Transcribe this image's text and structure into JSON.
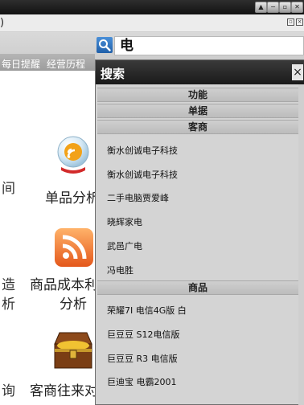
{
  "window": {
    "controls": [
      "▲",
      "−",
      "▫",
      "✕"
    ]
  },
  "menubar": {
    "left_glyph": ")"
  },
  "toolbar": {
    "links": [
      "每日提醒",
      "经营历程"
    ]
  },
  "search": {
    "value": "电",
    "icon": "search-icon"
  },
  "popup": {
    "title": "搜索",
    "close": "×",
    "sections": [
      {
        "label": "功能",
        "items": []
      },
      {
        "label": "单据",
        "items": []
      },
      {
        "label": "客商",
        "items": [
          "衡水创诚电子科技",
          "衡水创诚电子科技",
          "二手电脑贾爱峰",
          "晓辉家电",
          "武邑广电",
          "冯电胜"
        ]
      },
      {
        "label": "商品",
        "items": [
          "荣耀7I 电信4G版 白",
          "巨豆豆 S12电信版",
          "巨豆豆 R3 电信版",
          "巨迪宝 电霸2001"
        ]
      }
    ]
  },
  "left": {
    "fragments": [
      "间",
      "造",
      "析",
      "询"
    ],
    "labels": [
      "单品分析",
      "商品成本利",
      "分析",
      "客商往来对"
    ]
  },
  "colors": {
    "search_blue": "#2f75c6",
    "header_dark": "#1f1f1f",
    "section_gray": "#c4c4c4"
  }
}
